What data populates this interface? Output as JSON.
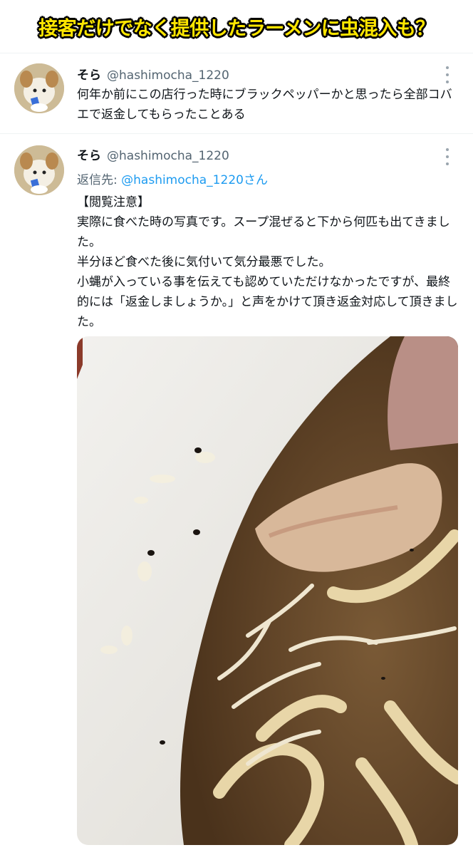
{
  "banner": {
    "title": "接客だけでなく提供したラーメンに虫混入も？",
    "title_color": "#ffe600"
  },
  "tweets": [
    {
      "display_name": "そら",
      "handle": "@hashimocha_1220",
      "text": "何年か前にこの店行った時にブラックペッパーかと思ったら全部コバエで返金してもらったことある"
    },
    {
      "display_name": "そら",
      "handle": "@hashimocha_1220",
      "reply_prefix": "返信先: ",
      "reply_to": "@hashimocha_1220さん",
      "text": "【閲覧注意】\n実際に食べた時の写真です。スープ混ぜると下から何匹も出てきました。\n半分ほど食べた後に気付いて気分最悪でした。\n小蝿が入っている事を伝えても認めていただけなかったですが、最終的には「返金しましょうか。」と声をかけて頂き返金対応して頂きました。"
    }
  ],
  "icons": {
    "more": "more-vertical-icon"
  },
  "colors": {
    "link": "#1d9bf0",
    "secondary_text": "#536471",
    "divider": "#eff3f4"
  }
}
